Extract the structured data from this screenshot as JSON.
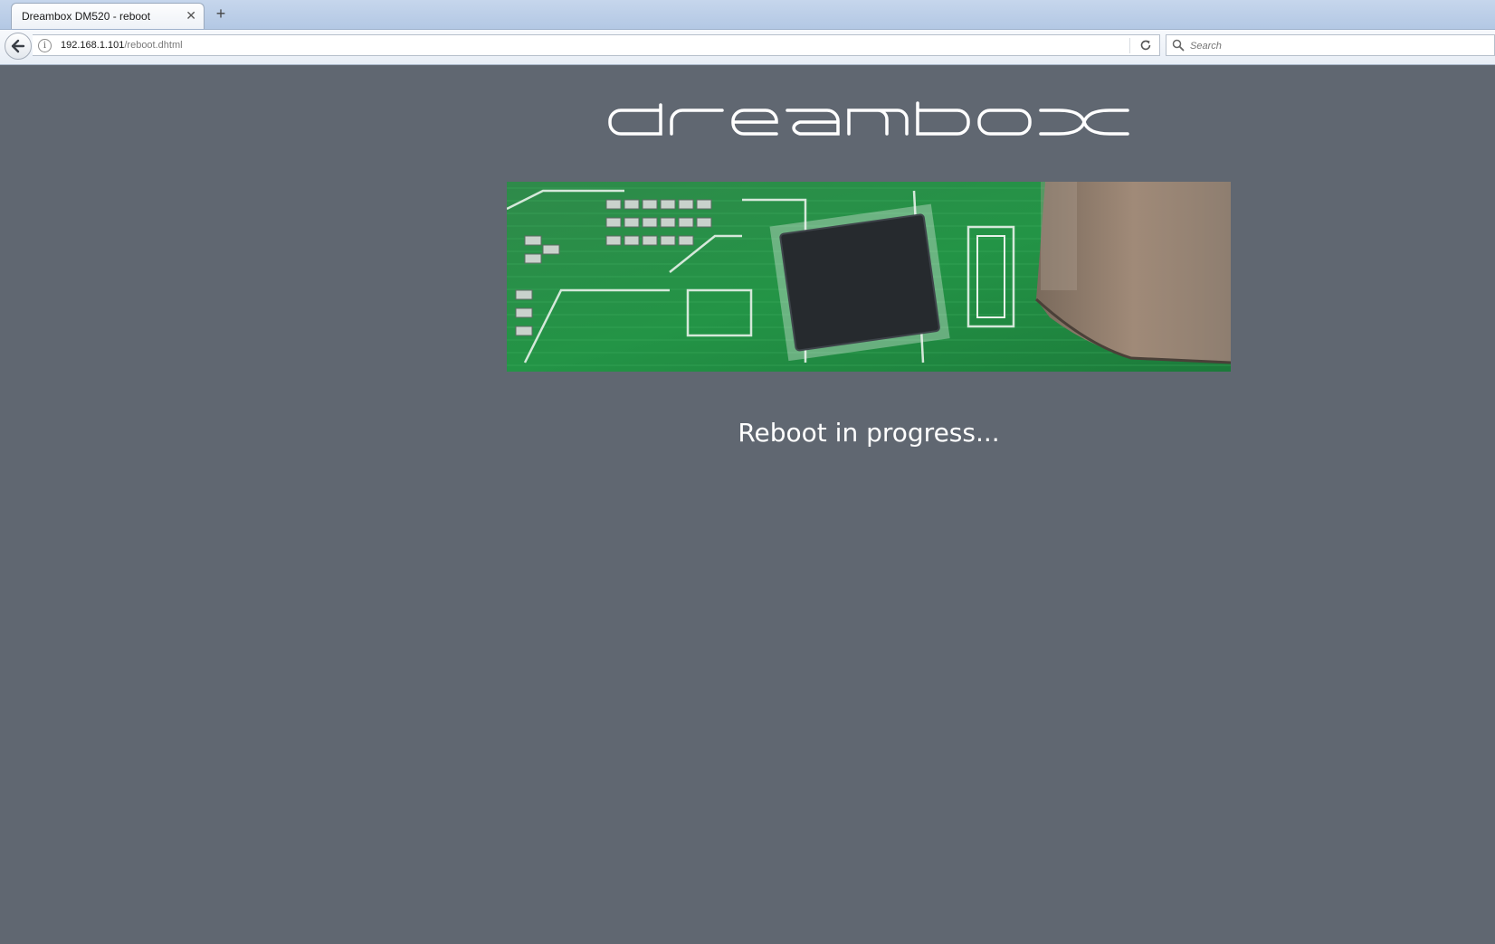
{
  "browser": {
    "tab": {
      "title": "Dreambox DM520 - reboot"
    },
    "url": {
      "host": "192.168.1.101",
      "path": "/reboot.dhtml"
    },
    "search": {
      "placeholder": "Search"
    }
  },
  "page": {
    "logo_text": "dreambox",
    "banner_icon": "circuit-board-photo",
    "status": "Reboot in progress..."
  },
  "colors": {
    "page_background": "#606771",
    "text": "#ffffff"
  }
}
